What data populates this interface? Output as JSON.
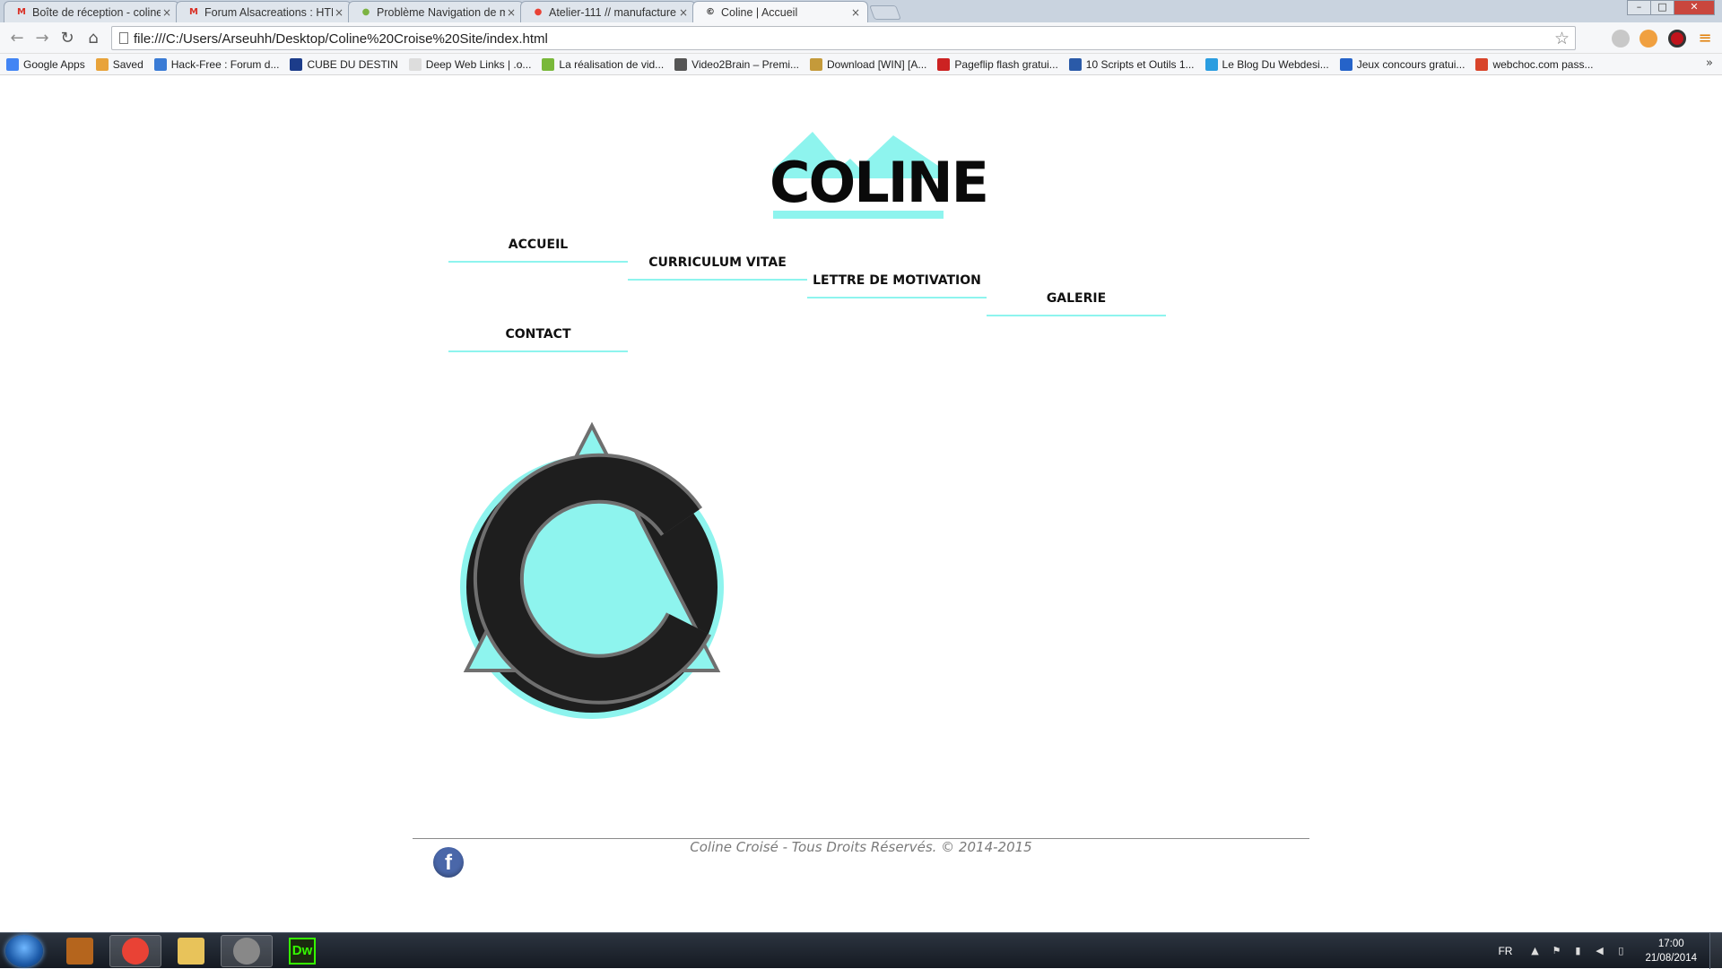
{
  "browser": {
    "tabs": [
      {
        "title": "Boîte de réception - coline",
        "favicon": "gmail-icon",
        "active": false
      },
      {
        "title": "Forum Alsacreations : HTML",
        "favicon": "gmail-icon",
        "active": false
      },
      {
        "title": "Problème Navigation de menu",
        "favicon": "forum-icon",
        "active": false
      },
      {
        "title": "Atelier-111 // manufacture",
        "favicon": "chrome-icon",
        "active": false
      },
      {
        "title": "Coline | Accueil",
        "favicon": "coline-icon",
        "active": true
      }
    ],
    "url": "file:///C:/Users/Arseuhh/Desktop/Coline%20Croise%20Site/index.html",
    "bookmarks": [
      {
        "label": "Google Apps",
        "icon": "apps-grid-icon",
        "color": "#4285f4"
      },
      {
        "label": "Saved",
        "icon": "saved-icon",
        "color": "#e8a33a"
      },
      {
        "label": "Hack-Free : Forum d...",
        "icon": "hackfree-icon",
        "color": "#3a7bd5"
      },
      {
        "label": "CUBE DU DESTIN",
        "icon": "cube-icon",
        "color": "#1c3c8a"
      },
      {
        "label": "Deep Web Links | .o...",
        "icon": "page-icon",
        "color": "#dddddd"
      },
      {
        "label": "La réalisation de vid...",
        "icon": "video-icon",
        "color": "#79b83a"
      },
      {
        "label": "Video2Brain – Premi...",
        "icon": "v2b-icon",
        "color": "#555555"
      },
      {
        "label": "Download [WIN] [A...",
        "icon": "shield-icon",
        "color": "#c49a3a"
      },
      {
        "label": "Pageflip flash gratui...",
        "icon": "pf-icon",
        "color": "#cc2222"
      },
      {
        "label": "10 Scripts et Outils 1...",
        "icon": "script-icon",
        "color": "#2a5aa8"
      },
      {
        "label": "Le Blog Du Webdesi...",
        "icon": "blog-icon",
        "color": "#2a9de0"
      },
      {
        "label": "Jeux concours gratui...",
        "icon": "jeux-icon",
        "color": "#2563c9"
      },
      {
        "label": "webchoc.com pass...",
        "icon": "webchoc-icon",
        "color": "#d8442a"
      }
    ]
  },
  "site": {
    "logo_text": "COLINE",
    "accent_color": "#8ef4ee",
    "nav": [
      {
        "label": "ACCUEIL",
        "name": "nav-accueil"
      },
      {
        "label": "CURRICULUM VITAE",
        "name": "nav-curriculum-vitae"
      },
      {
        "label": "LETTRE DE MOTIVATION",
        "name": "nav-lettre-de-motivation"
      },
      {
        "label": "GALERIE",
        "name": "nav-galerie"
      },
      {
        "label": "CONTACT",
        "name": "nav-contact"
      }
    ],
    "footer": {
      "copyright": "Coline Croisé - Tous Droits Réservés. © 2014-2015",
      "facebook_letter": "f"
    }
  },
  "taskbar": {
    "apps": [
      {
        "name": "taskbar-app-game",
        "icon": "game-icon"
      },
      {
        "name": "taskbar-app-chrome",
        "icon": "chrome-icon"
      },
      {
        "name": "taskbar-app-explorer",
        "icon": "folder-icon"
      },
      {
        "name": "taskbar-app-media",
        "icon": "media-icon"
      },
      {
        "name": "taskbar-app-dreamweaver",
        "icon": "dreamweaver-icon",
        "label": "Dw"
      }
    ],
    "language": "FR",
    "time": "17:00",
    "date": "21/08/2014"
  }
}
